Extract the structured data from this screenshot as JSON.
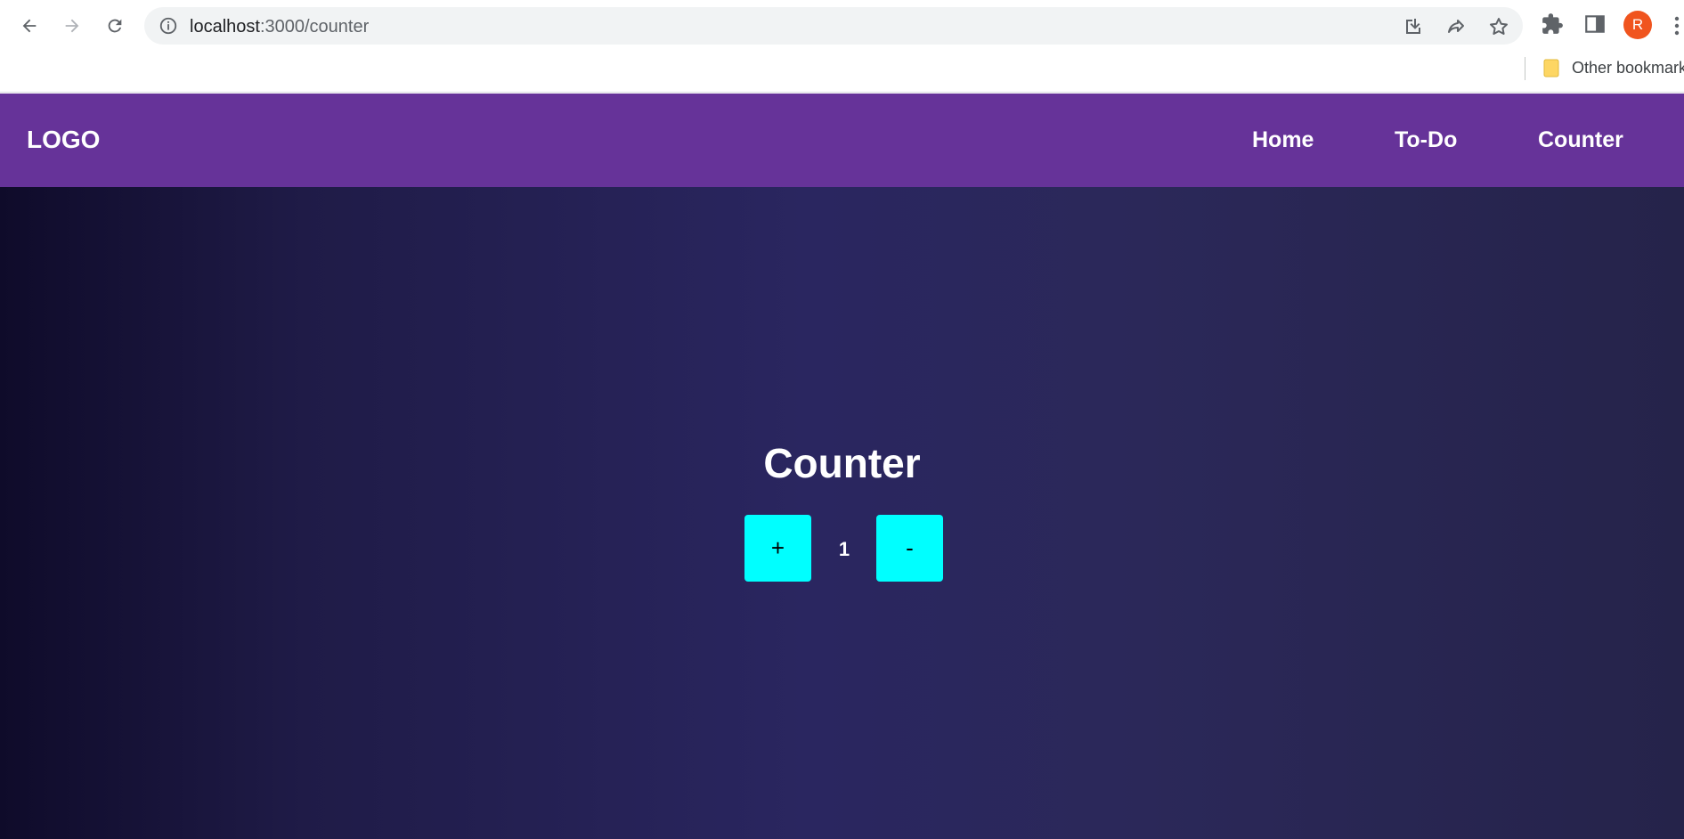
{
  "browser": {
    "url_host": "localhost",
    "url_path": ":3000/counter",
    "avatar_letter": "R",
    "bookmark_folder_label": "Other bookmarks"
  },
  "app": {
    "logo": "LOGO",
    "nav": [
      "Home",
      "To-Do",
      "Counter"
    ],
    "colors": {
      "header": "#663399",
      "button": "#00ffff"
    }
  },
  "counter": {
    "title": "Counter",
    "increment_label": "+",
    "decrement_label": "-",
    "value": "1"
  }
}
